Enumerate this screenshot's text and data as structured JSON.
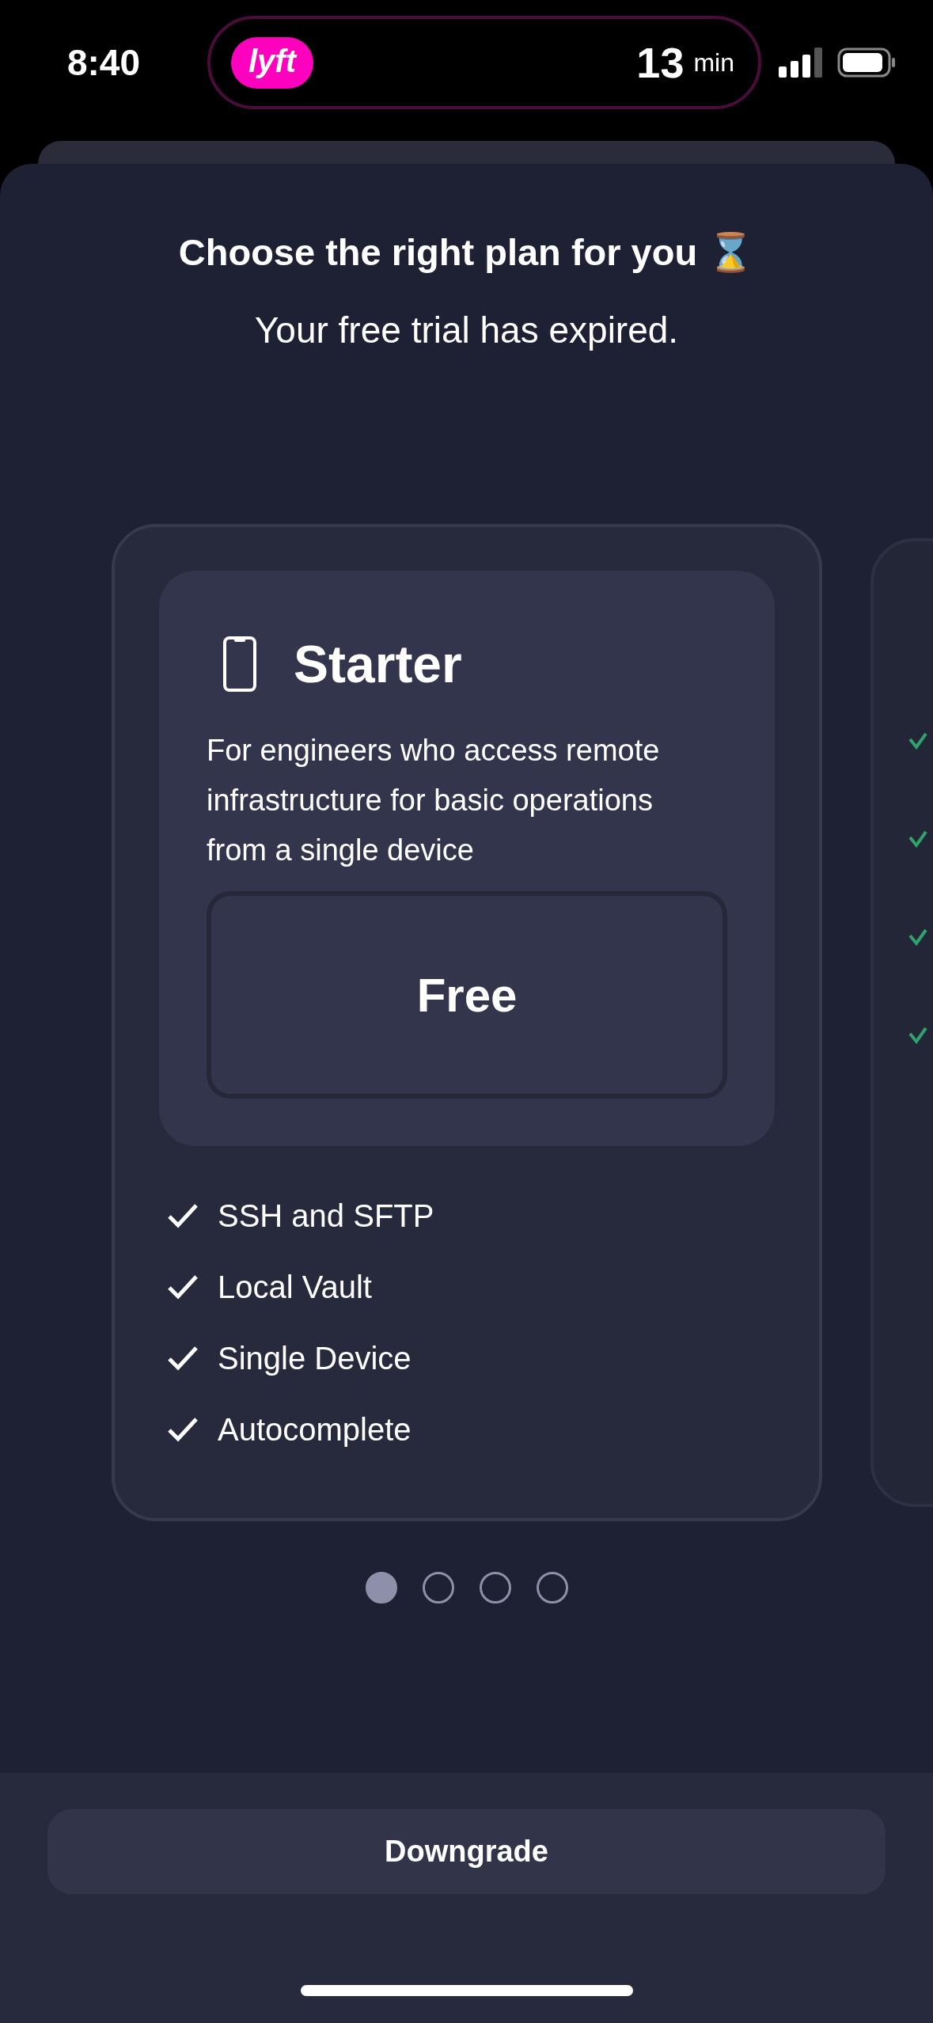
{
  "status_bar": {
    "time": "8:40",
    "live_activity": {
      "app_badge": "lyft",
      "eta_value": "13",
      "eta_unit": "min"
    }
  },
  "header": {
    "title": "Choose the right plan for you ⌛",
    "subtitle": "Your free trial has expired."
  },
  "plan": {
    "name": "Starter",
    "description": "For engineers who access remote infrastructure for basic operations from a single device",
    "price": "Free",
    "features": [
      "SSH and SFTP",
      "Local Vault",
      "Single Device",
      "Autocomplete"
    ]
  },
  "pager": [
    {
      "selected": true
    },
    {
      "selected": false
    },
    {
      "selected": false
    },
    {
      "selected": false
    }
  ],
  "footer": {
    "button": "Downgrade"
  }
}
